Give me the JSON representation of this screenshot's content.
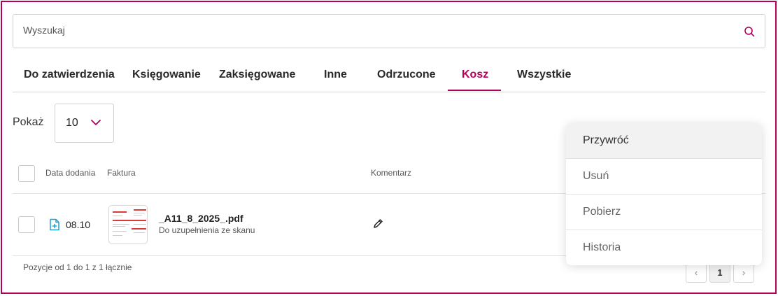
{
  "colors": {
    "accent": "#b5005a",
    "file_icon": "#1da1d8",
    "thumb_red": "#d93a3a"
  },
  "search": {
    "placeholder": "Wyszukaj",
    "icon": "search-icon"
  },
  "tabs": [
    {
      "label": "Do zatwierdzenia"
    },
    {
      "label": "Księgowanie"
    },
    {
      "label": "Zaksięgowane"
    },
    {
      "label": "Inne"
    },
    {
      "label": "Odrzucone"
    },
    {
      "label": "Kosz",
      "active": true
    },
    {
      "label": "Wszystkie"
    }
  ],
  "page_size": {
    "label": "Pokaż",
    "value": "10"
  },
  "table": {
    "columns": [
      "Data dodania",
      "Faktura",
      "Komentarz"
    ],
    "rows": [
      {
        "date": "08.10",
        "file_name": "_A11_8_2025_.pdf",
        "status": "Do uzupełnienia ze skanu"
      }
    ]
  },
  "footer": {
    "summary": "Pozycje od 1 do 1 z 1 łącznie",
    "prev": "‹",
    "current_page": "1",
    "next": "›"
  },
  "context_menu": {
    "items": [
      {
        "label": "Przywróć",
        "hovered": true
      },
      {
        "label": "Usuń"
      },
      {
        "label": "Pobierz"
      },
      {
        "label": "Historia"
      }
    ]
  }
}
